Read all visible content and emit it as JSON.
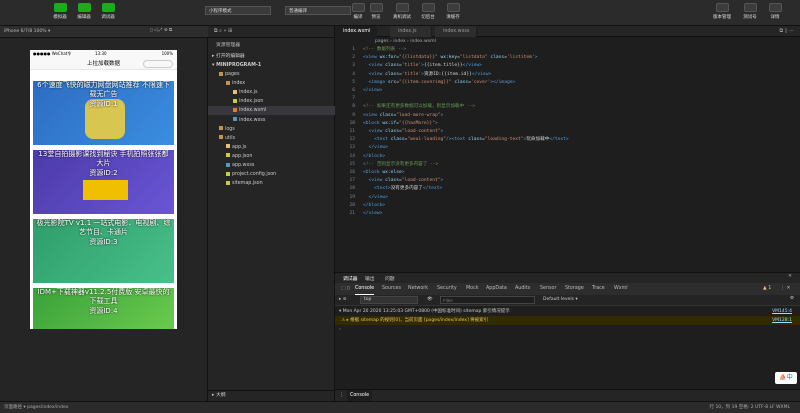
{
  "toolbar": {
    "buttons": [
      {
        "label": "模拟器"
      },
      {
        "label": "编辑器"
      },
      {
        "label": "调试器"
      }
    ],
    "mode_select": "小程序模式",
    "compile_select": "普通编译",
    "right_buttons": [
      {
        "label": "编译"
      },
      {
        "label": "预览"
      },
      {
        "label": "真机调试"
      },
      {
        "label": "切后台"
      },
      {
        "label": "清缓存"
      }
    ],
    "far_buttons": [
      {
        "label": "版本管理"
      },
      {
        "label": "测试号"
      },
      {
        "label": "详情"
      }
    ]
  },
  "simulator": {
    "device": "iPhone 6/7/8 100% ▾",
    "status_left": "●●●●● WeChat令",
    "status_time": "13:30",
    "status_right": "100%",
    "nav_title": "上拉加载数据",
    "cards": [
      {
        "title": "6个速度飞快的磁力网盘网站推荐 不限速下载无广告",
        "id_text": "资源ID:1",
        "bg": "#2d6cc2"
      },
      {
        "title": "13堂自拍摄影课找到秘诀 手机拍照张张都大片",
        "id_text": "资源ID:2",
        "bg": "#4b3aa8"
      },
      {
        "title": "极光影院TV v1.1 一站式电影、电视剧、综艺节目、卡通片",
        "id_text": "资源ID:3",
        "bg": "#2e9e6a"
      },
      {
        "title": "IDM+下载神器v11.2.5付费版 安卓最快的下载工具",
        "id_text": "资源ID:4",
        "bg": "#3aa23a"
      }
    ]
  },
  "explorer": {
    "title": "资源管理器",
    "open_editors": "打开的编辑器",
    "project": "MINIPROGRAM-1",
    "items": [
      {
        "label": "pages",
        "indent": 1,
        "type": "folder"
      },
      {
        "label": "index",
        "indent": 2,
        "type": "folder"
      },
      {
        "label": "index.js",
        "indent": 3,
        "type": "js"
      },
      {
        "label": "index.json",
        "indent": 3,
        "type": "json"
      },
      {
        "label": "index.wxml",
        "indent": 3,
        "type": "wxml"
      },
      {
        "label": "index.wxss",
        "indent": 3,
        "type": "wxss"
      },
      {
        "label": "logs",
        "indent": 1,
        "type": "folder"
      },
      {
        "label": "utils",
        "indent": 1,
        "type": "folder"
      },
      {
        "label": "app.js",
        "indent": 2,
        "type": "js"
      },
      {
        "label": "app.json",
        "indent": 2,
        "type": "json"
      },
      {
        "label": "app.wxss",
        "indent": 2,
        "type": "wxss"
      },
      {
        "label": "project.config.json",
        "indent": 2,
        "type": "json"
      },
      {
        "label": "sitemap.json",
        "indent": 2,
        "type": "json"
      }
    ],
    "outline": "大纲"
  },
  "editor": {
    "tabs": [
      {
        "label": "index.wxml"
      },
      {
        "label": "index.js"
      },
      {
        "label": "index.wxss"
      }
    ],
    "breadcrumb": "pages › index › index.wxml"
  },
  "devtools": {
    "top_tabs": [
      "调试器",
      "输出",
      "问题"
    ],
    "tabs": [
      "Console",
      "Sources",
      "Network",
      "Security",
      "Mock",
      "AppData",
      "Audits",
      "Sensor",
      "Storage",
      "Trace",
      "Wxml"
    ],
    "context": "top",
    "filter_placeholder": "Filter",
    "levels": "Default levels ▾",
    "msg1": "▾ Mon Apr 20 2020 13:25:03 GMT+0800 (中国标准时间) sitemap 索引情况提示",
    "msg1_src": "VM145:4",
    "msg2": "⚠ ▸ 根据 sitemap 的规则[0]，当前页面 [pages/index/index] 将被索引",
    "msg2_src": "VM128:1",
    "drawer_tab": "Console"
  },
  "statusbar": {
    "left": "页面路径 ▾    pages/index/index",
    "right": "行 10，列 19 空格: 2  UTF-8  LF  WXML"
  }
}
